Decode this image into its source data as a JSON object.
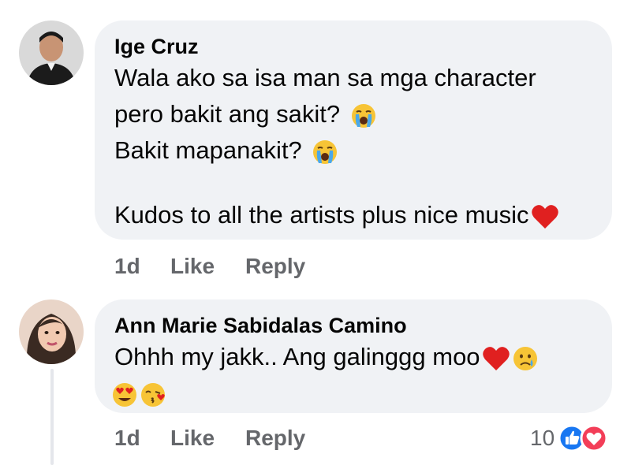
{
  "comments": [
    {
      "author": "Ige Cruz",
      "lines": [
        "Wala ako sa isa man sa mga character",
        "pero bakit ang sakit?",
        "Bakit mapanakit?",
        "Kudos to all the artists plus nice music"
      ],
      "time": "1d",
      "like_label": "Like",
      "reply_label": "Reply"
    },
    {
      "author": "Ann Marie Sabidalas Camino",
      "lines": [
        "Ohhh my jakk.. Ang galinggg moo"
      ],
      "time": "1d",
      "like_label": "Like",
      "reply_label": "Reply",
      "reaction_count": "10",
      "reaction_icons": [
        "like-icon",
        "love-icon"
      ]
    }
  ]
}
